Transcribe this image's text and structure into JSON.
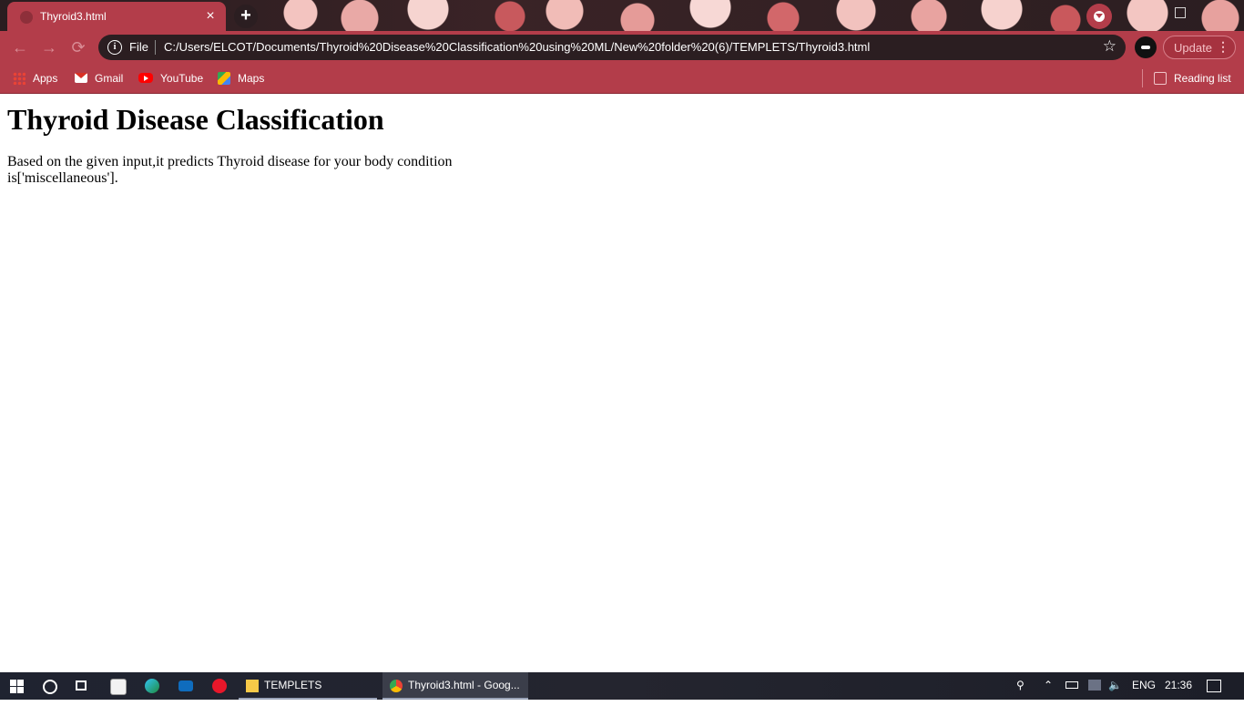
{
  "browser": {
    "tab_title": "Thyroid3.html",
    "tab_close": "×",
    "new_tab": "+",
    "url_scheme": "File",
    "url": "C:/Users/ELCOT/Documents/Thyroid%20Disease%20Classification%20using%20ML/New%20folder%20(6)/TEMPLETS/Thyroid3.html",
    "update_label": "Update",
    "menu_label": "⋮",
    "back": "←",
    "forward": "→",
    "reload": "⟳",
    "star": "☆"
  },
  "bookmarks": {
    "items": [
      {
        "label": "Apps",
        "icon": "apps-grid-icon"
      },
      {
        "label": "Gmail",
        "icon": "gmail-icon"
      },
      {
        "label": "YouTube",
        "icon": "youtube-icon"
      },
      {
        "label": "Maps",
        "icon": "maps-icon"
      }
    ],
    "reading_list": "Reading list"
  },
  "page": {
    "heading": "Thyroid Disease Classification",
    "result_text": "Based on the given input,it predicts Thyroid disease for your body condition is['miscellaneous']."
  },
  "taskbar": {
    "items": [
      {
        "label": "TEMPLETS",
        "icon": "folder-icon"
      },
      {
        "label": "Thyroid3.html - Goog...",
        "icon": "chrome-icon"
      }
    ],
    "language": "ENG",
    "time": "21:36"
  },
  "colors": {
    "chrome_accent": "#b33d4a",
    "omnibox_bg": "#2b1e21",
    "taskbar_bg": "#1f2330"
  }
}
